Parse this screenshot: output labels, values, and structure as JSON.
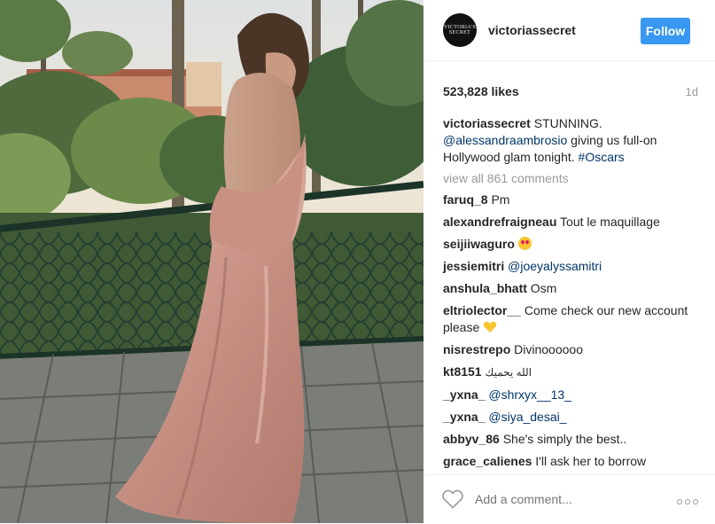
{
  "post": {
    "account": {
      "username": "victoriassecret",
      "avatar_text": "VICTORIA'S SECRET",
      "follow_label": "Follow"
    },
    "likes": "523,828 likes",
    "age": "1d",
    "caption": {
      "user": "victoriassecret",
      "text_1": "STUNNING.",
      "mention": "@alessandraambrosio",
      "text_2": "giving us full-on Hollywood glam tonight.",
      "hashtag": "#Oscars"
    },
    "view_all": "view all 861 comments",
    "comments": [
      {
        "user": "faruq_8",
        "text": "Pm"
      },
      {
        "user": "alexandrefraigneau",
        "text": "Tout le maquillage"
      },
      {
        "user": "seijiiwaguro",
        "text": "",
        "emoji": "heart-eyes-emoji"
      },
      {
        "user": "jessiemitri",
        "text": "",
        "mention": "@joeyalyssamitri"
      },
      {
        "user": "anshula_bhatt",
        "text": "Osm"
      },
      {
        "user": "eltriolector__",
        "text": "Come check our new account please",
        "emoji": "yellow-heart-emoji"
      },
      {
        "user": "nisrestrepo",
        "text": "Divinoooooo"
      },
      {
        "user": "kt8151",
        "text": "الله يحميك"
      },
      {
        "user": "_yxna_",
        "text": "",
        "mention": "@shrxyx__13_"
      },
      {
        "user": "_yxna_",
        "text": "",
        "mention": "@siya_desai_"
      },
      {
        "user": "abbyv_86",
        "text": "She's simply the best.."
      },
      {
        "user": "grace_calienes",
        "text": "I'll ask her to borrow"
      }
    ],
    "add_comment_placeholder": "Add a comment...",
    "icons": {
      "like": "heart-outline-icon",
      "more": "more-options-icon"
    },
    "colors": {
      "follow_bg": "#3897f0",
      "link": "#003569",
      "muted": "#999999"
    }
  }
}
